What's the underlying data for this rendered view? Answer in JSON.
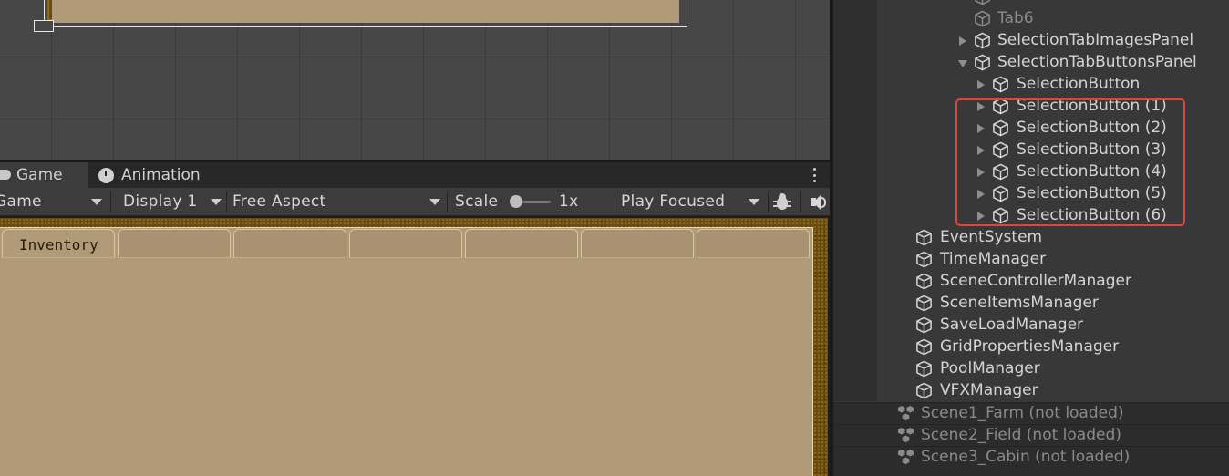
{
  "game_view": {
    "tabs": [
      {
        "label": "Game"
      },
      {
        "label": "Animation"
      }
    ],
    "toolbar": {
      "view_select": "Game",
      "display": "Display 1",
      "aspect": "Free Aspect",
      "scale_label": "Scale",
      "scale_value": "1x",
      "play_mode": "Play Focused"
    },
    "inventory": {
      "tabs": [
        {
          "label": "Inventory"
        },
        {
          "label": ""
        },
        {
          "label": ""
        },
        {
          "label": ""
        },
        {
          "label": ""
        },
        {
          "label": ""
        },
        {
          "label": ""
        }
      ]
    }
  },
  "hierarchy": {
    "items": [
      {
        "label": "Tab6"
      },
      {
        "label": "SelectionTabImagesPanel"
      },
      {
        "label": "SelectionTabButtonsPanel"
      },
      {
        "label": "SelectionButton"
      },
      {
        "label": "SelectionButton (1)"
      },
      {
        "label": "SelectionButton (2)"
      },
      {
        "label": "SelectionButton (3)"
      },
      {
        "label": "SelectionButton (4)"
      },
      {
        "label": "SelectionButton (5)"
      },
      {
        "label": "SelectionButton (6)"
      },
      {
        "label": "EventSystem"
      },
      {
        "label": "TimeManager"
      },
      {
        "label": "SceneControllerManager"
      },
      {
        "label": "SceneItemsManager"
      },
      {
        "label": "SaveLoadManager"
      },
      {
        "label": "GridPropertiesManager"
      },
      {
        "label": "PoolManager"
      },
      {
        "label": "VFXManager"
      }
    ],
    "scenes": [
      {
        "label": "Scene1_Farm (not loaded)"
      },
      {
        "label": "Scene2_Field (not loaded)"
      },
      {
        "label": "Scene3_Cabin (not loaded)"
      }
    ]
  },
  "colors": {
    "highlight": "#e0453a",
    "parchment": "#b09a78",
    "wood": "#6d4f12"
  }
}
